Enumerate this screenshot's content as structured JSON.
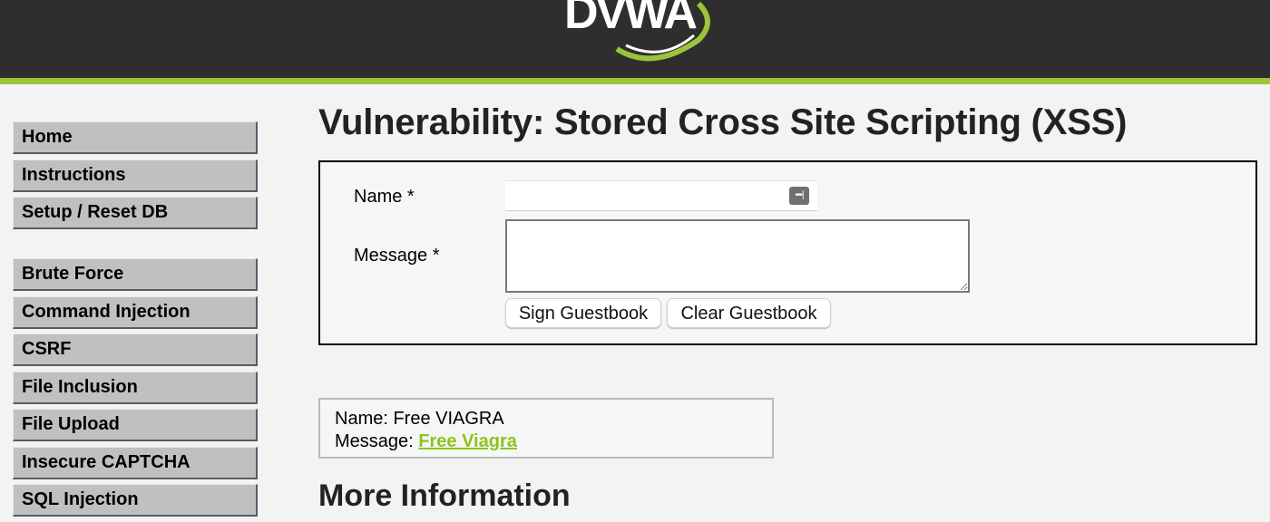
{
  "header": {
    "logo_text": "DVWA",
    "accent_color": "#9ac43a"
  },
  "menu": {
    "group1": [
      "Home",
      "Instructions",
      "Setup / Reset DB"
    ],
    "group2": [
      "Brute Force",
      "Command Injection",
      "CSRF",
      "File Inclusion",
      "File Upload",
      "Insecure CAPTCHA",
      "SQL Injection"
    ]
  },
  "page": {
    "title": "Vulnerability: Stored Cross Site Scripting (XSS)",
    "form": {
      "name_label": "Name *",
      "name_value": "",
      "message_label": "Message *",
      "message_value": "",
      "sign_button": "Sign Guestbook",
      "clear_button": "Clear Guestbook"
    },
    "entry": {
      "name_line": "Name: Free VIAGRA",
      "message_prefix": "Message: ",
      "message_link": "Free Viagra"
    },
    "more_info_heading": "More Information"
  }
}
